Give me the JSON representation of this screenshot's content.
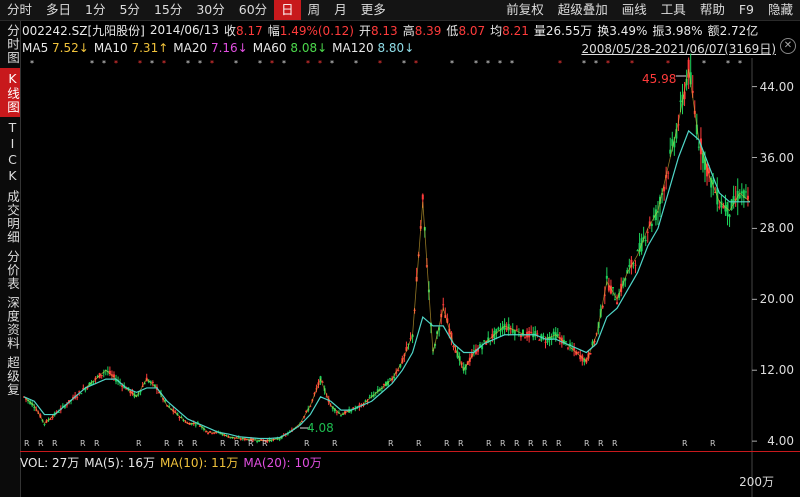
{
  "periods": [
    "分时",
    "多日",
    "1分",
    "5分",
    "15分",
    "30分",
    "60分",
    "日",
    "周",
    "月",
    "更多"
  ],
  "active_period": "日",
  "right_menu": [
    "前复权",
    "超级叠加",
    "画线",
    "工具",
    "帮助",
    "F9",
    "隐藏"
  ],
  "side_tabs": [
    "分时图",
    "K线图",
    "TICK",
    "成交明细",
    "分价表",
    "深度资料",
    "超级复"
  ],
  "active_side": "K线图",
  "stock": {
    "code_name": "002242.SZ[九阳股份]",
    "date": "2014/06/13"
  },
  "quote": [
    {
      "label": "收",
      "value": "8.17",
      "color": "red"
    },
    {
      "label": "幅",
      "value": "1.49%(0.12)",
      "color": "red"
    },
    {
      "label": "开",
      "value": "8.13",
      "color": "red"
    },
    {
      "label": "高",
      "value": "8.39",
      "color": "red"
    },
    {
      "label": "低",
      "value": "8.07",
      "color": "red"
    },
    {
      "label": "均",
      "value": "8.21",
      "color": "red"
    },
    {
      "label": "量",
      "value": "26.55万",
      "color": "white"
    },
    {
      "label": "换",
      "value": "3.49%",
      "color": "white"
    },
    {
      "label": "振",
      "value": "3.98%",
      "color": "white"
    },
    {
      "label": "额",
      "value": "2.72亿",
      "color": "white"
    }
  ],
  "ma": [
    {
      "label": "MA5",
      "value": "7.52↓",
      "color": "yellow"
    },
    {
      "label": "MA10",
      "value": "7.31↑",
      "color": "yellow"
    },
    {
      "label": "MA20",
      "value": "7.16↓",
      "color": "magenta"
    },
    {
      "label": "MA60",
      "value": "8.08↓",
      "color": "lgreen"
    },
    {
      "label": "MA120",
      "value": "8.80↓",
      "color": "cyan"
    }
  ],
  "date_range": "2008/05/28-2021/06/07(3169日)",
  "y_ticks": [
    "44.00",
    "36.00",
    "28.00",
    "20.00",
    "12.00",
    "4.00"
  ],
  "y_tick_values": [
    44,
    36,
    28,
    20,
    12,
    4
  ],
  "high_label": "45.98",
  "low_label": "4.08",
  "vol": {
    "items": [
      {
        "label": "VOL:",
        "value": "27万",
        "color": "white"
      },
      {
        "label": "MA(5):",
        "value": "16万",
        "color": "white"
      },
      {
        "label": "MA(10):",
        "value": "11万",
        "color": "yellow"
      },
      {
        "label": "MA(20):",
        "value": "10万",
        "color": "magenta"
      }
    ],
    "axis_label": "200万"
  },
  "chart_data": {
    "type": "line",
    "ylim": [
      3,
      47
    ],
    "x_range": [
      "2008/05/28",
      "2021/06/07"
    ],
    "series": [
      {
        "values": [
          9,
          8,
          6,
          7,
          8,
          9,
          10,
          11,
          12,
          11,
          10,
          9,
          11,
          10,
          8,
          7,
          6,
          6,
          5,
          5,
          4.5,
          4.3,
          4.2,
          4.1,
          4.08,
          4.3,
          5,
          6,
          8,
          11,
          8,
          7,
          7.5,
          8,
          9,
          10,
          11,
          13,
          16,
          31,
          14,
          19,
          15,
          12,
          14,
          15,
          16,
          17,
          16.5,
          16,
          16,
          15.5,
          16,
          15,
          14,
          13,
          16,
          22,
          20,
          23,
          25,
          28,
          30,
          35,
          40,
          45.98,
          38,
          34,
          31,
          30,
          32,
          31
        ]
      },
      {
        "values": [
          9,
          8.5,
          7,
          7,
          8,
          9,
          10,
          10.5,
          11,
          11,
          10,
          9.5,
          10,
          10,
          8.5,
          7.5,
          6.5,
          6,
          5.5,
          5,
          4.8,
          4.5,
          4.4,
          4.3,
          4.3,
          4.4,
          5,
          5.8,
          7,
          9,
          8.5,
          7.5,
          7.5,
          8,
          8.5,
          9.5,
          10.5,
          12,
          14,
          18,
          17,
          17,
          15,
          14,
          14,
          15,
          15.5,
          16,
          16,
          16,
          16,
          15.5,
          15.5,
          15,
          14.5,
          14,
          15,
          18,
          19,
          21,
          23,
          26,
          28,
          32,
          36,
          39,
          38,
          35,
          32,
          31,
          31,
          31
        ]
      }
    ]
  }
}
